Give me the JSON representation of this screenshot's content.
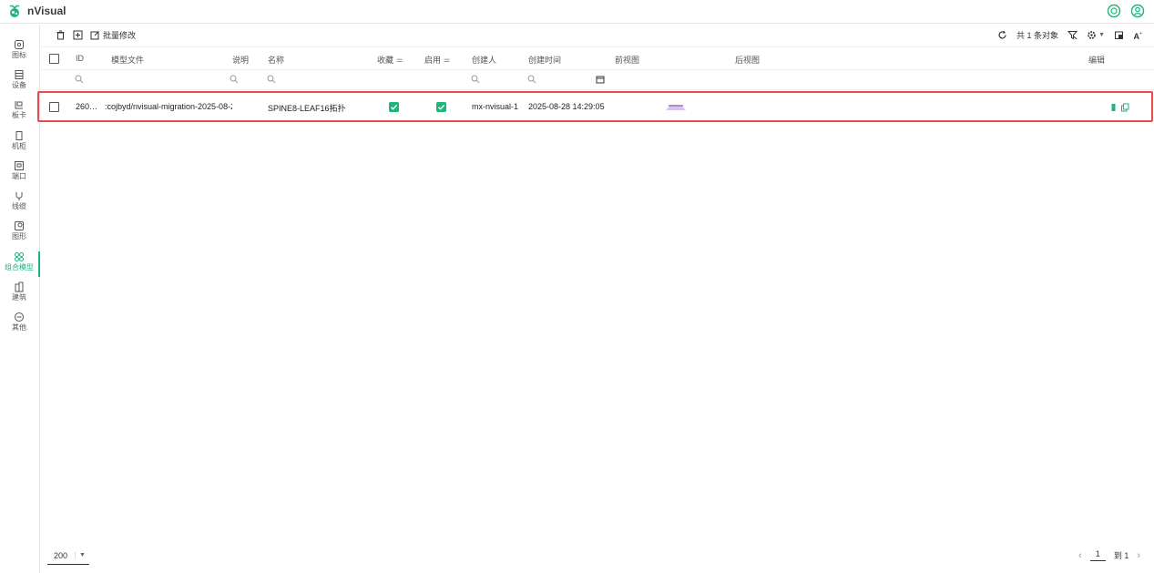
{
  "app": {
    "name": "nVisual"
  },
  "sidebar": {
    "items": [
      {
        "label": "图标",
        "icon": "gallery-icon",
        "active": false
      },
      {
        "label": "设备",
        "icon": "device-icon",
        "active": false
      },
      {
        "label": "板卡",
        "icon": "card-icon",
        "active": false
      },
      {
        "label": "机柜",
        "icon": "cabinet-icon",
        "active": false
      },
      {
        "label": "端口",
        "icon": "port-icon",
        "active": false
      },
      {
        "label": "线缆",
        "icon": "cable-icon",
        "active": false
      },
      {
        "label": "图形",
        "icon": "shape-icon",
        "active": false
      },
      {
        "label": "组合模型",
        "icon": "combo-model-icon",
        "active": true
      },
      {
        "label": "建筑",
        "icon": "building-icon",
        "active": false
      },
      {
        "label": "其他",
        "icon": "other-icon",
        "active": false
      }
    ]
  },
  "toolbar": {
    "batch_edit_label": "批量修改",
    "total_text": "共 1 条对象"
  },
  "table": {
    "columns": {
      "id": "ID",
      "model_file": "模型文件",
      "desc": "说明",
      "name": "名称",
      "favorite": "收藏",
      "enabled": "启用",
      "creator": "创建人",
      "created_time": "创建时间",
      "front_view": "前视图",
      "back_view": "后视图",
      "edit": "编辑"
    },
    "rows": [
      {
        "id": "260…",
        "model_file": ":cojbyd/nvisual-migration-2025-08-2",
        "desc": "",
        "name": "SPINE8-LEAF16拓扑",
        "favorite": true,
        "enabled": true,
        "creator": "mx-nvisual-1",
        "created_time": "2025-08-28 14:29:05"
      }
    ]
  },
  "footer": {
    "page_size": "200",
    "current_page": "1",
    "to_label": "到 1"
  },
  "colors": {
    "accent": "#1fb47a",
    "highlight": "#e94b4b"
  }
}
